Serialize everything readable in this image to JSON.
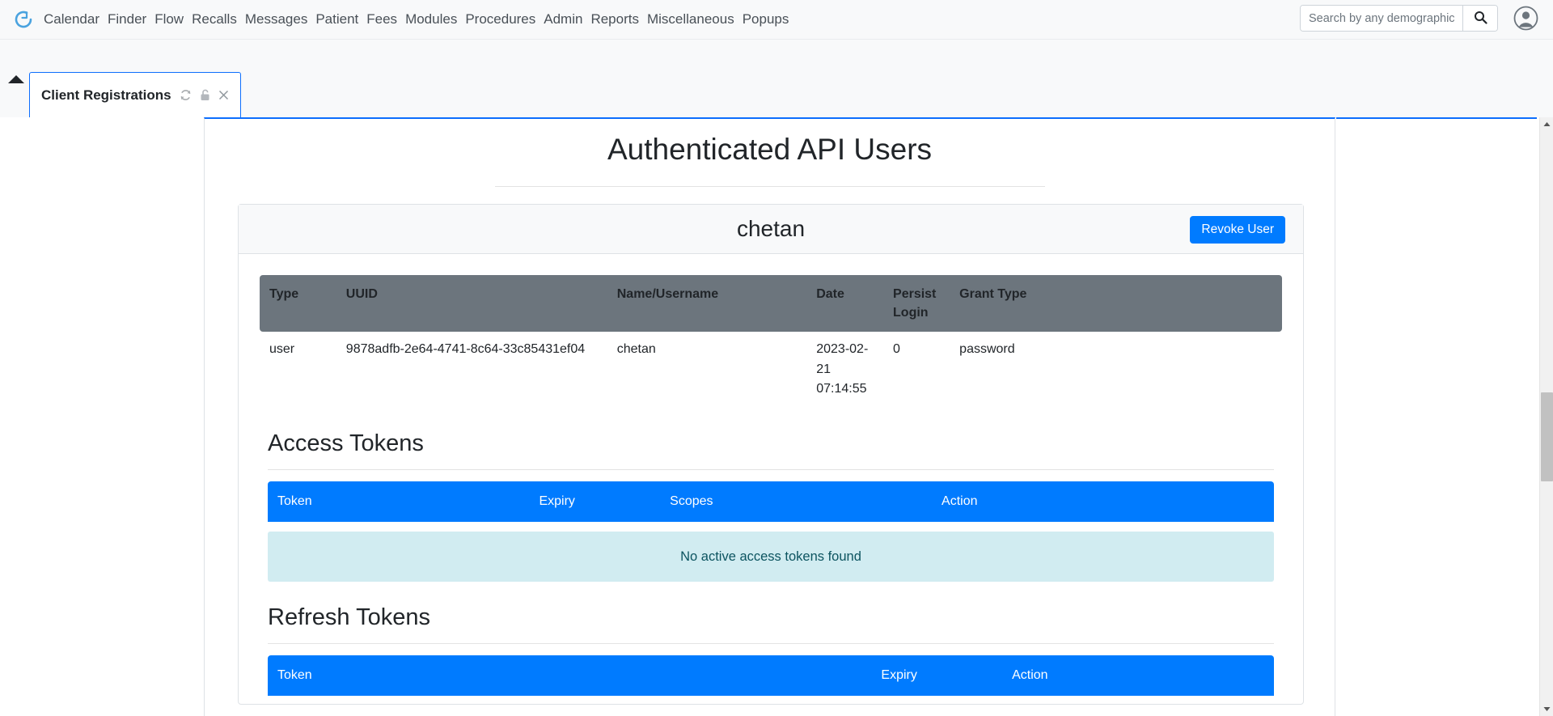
{
  "topnav": {
    "logo_icon": "ring-logo-icon",
    "items": [
      {
        "label": "Calendar",
        "name": "nav-item-calendar"
      },
      {
        "label": "Finder",
        "name": "nav-item-finder"
      },
      {
        "label": "Flow",
        "name": "nav-item-flow"
      },
      {
        "label": "Recalls",
        "name": "nav-item-recalls"
      },
      {
        "label": "Messages",
        "name": "nav-item-messages"
      },
      {
        "label": "Patient",
        "name": "nav-item-patient"
      },
      {
        "label": "Fees",
        "name": "nav-item-fees"
      },
      {
        "label": "Modules",
        "name": "nav-item-modules"
      },
      {
        "label": "Procedures",
        "name": "nav-item-procedures"
      },
      {
        "label": "Admin",
        "name": "nav-item-admin"
      },
      {
        "label": "Reports",
        "name": "nav-item-reports"
      },
      {
        "label": "Miscellaneous",
        "name": "nav-item-miscellaneous"
      },
      {
        "label": "Popups",
        "name": "nav-item-popups"
      }
    ],
    "search": {
      "placeholder": "Search by any demographics",
      "value": "",
      "button_icon": "search-icon"
    },
    "account_icon": "user-account-icon"
  },
  "tabstrip": {
    "collapse_icon": "triangle-up-icon",
    "tab": {
      "label": "Client Registrations",
      "refresh_icon": "refresh-icon",
      "lock_icon": "lock-icon",
      "close_icon": "close-icon"
    }
  },
  "page": {
    "title": "Authenticated API Users"
  },
  "card": {
    "username": "chetan",
    "revoke_label": "Revoke User",
    "user_table": {
      "headers": [
        "Type",
        "UUID",
        "Name/Username",
        "Date",
        "Persist Login",
        "Grant Type"
      ],
      "rows": [
        {
          "type": "user",
          "uuid": "9878adfb-2e64-4741-8c64-33c85431ef04",
          "name": "chetan",
          "date": "2023-02-21 07:14:55",
          "persist_login": "0",
          "grant_type": "password"
        }
      ]
    },
    "access_tokens": {
      "heading": "Access Tokens",
      "headers": [
        "Token",
        "Expiry",
        "Scopes",
        "Action"
      ],
      "empty_message": "No active access tokens found"
    },
    "refresh_tokens": {
      "heading": "Refresh Tokens",
      "headers": [
        "Token",
        "Expiry",
        "Action"
      ]
    }
  },
  "colors": {
    "accent_blue": "#007bff",
    "tab_border_blue": "#0d6efd",
    "table_header_gray": "#6c757d",
    "info_bg": "#d1ecf1",
    "info_text": "#0c5460"
  },
  "scrollbar": {
    "up_icon": "scroll-up-icon",
    "down_icon": "scroll-down-icon"
  }
}
